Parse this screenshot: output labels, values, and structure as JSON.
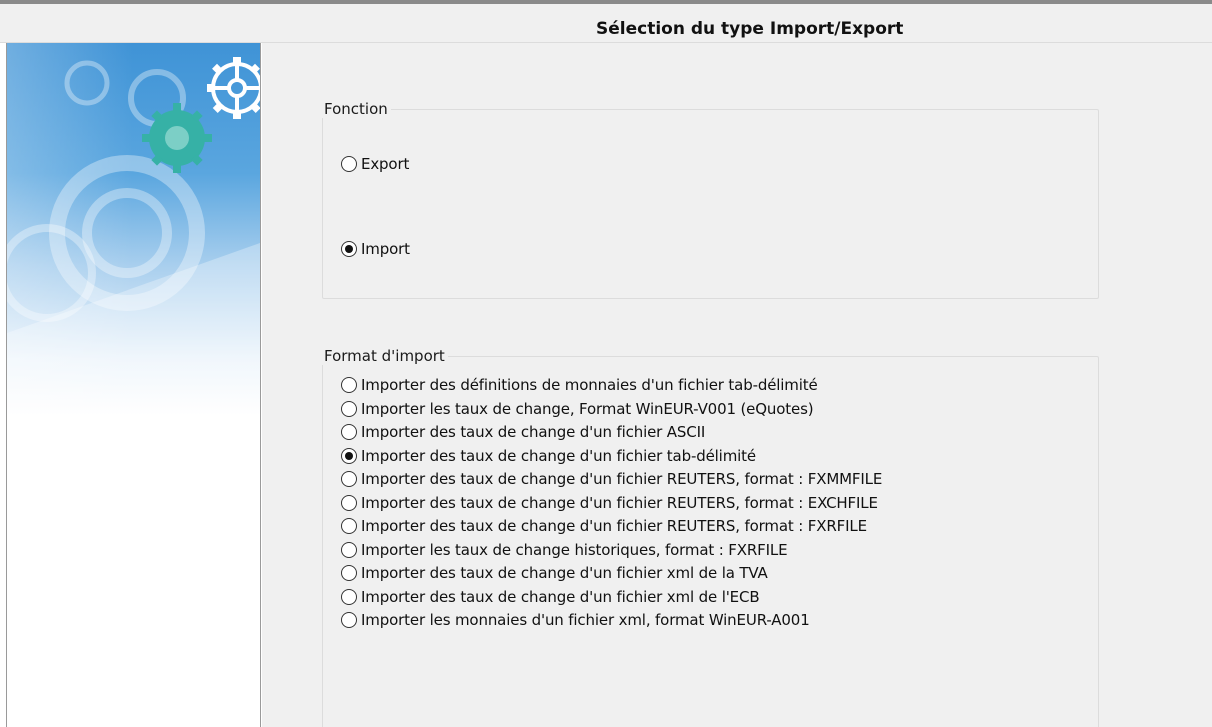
{
  "window": {
    "title": "Sélection du type Import/Export"
  },
  "sidebar": {
    "banner_icon": "gears-icon"
  },
  "fonction": {
    "title": "Fonction",
    "options": [
      {
        "label": "Export",
        "selected": false
      },
      {
        "label": "Import",
        "selected": true
      }
    ]
  },
  "format": {
    "title": "Format d'import",
    "options": [
      {
        "label": "Importer des définitions de monnaies d'un fichier tab-délimité",
        "selected": false
      },
      {
        "label": "Importer les taux de change, Format WinEUR-V001 (eQuotes)",
        "selected": false
      },
      {
        "label": "Importer des taux de change d'un fichier ASCII",
        "selected": false
      },
      {
        "label": "Importer des taux de change d'un fichier tab-délimité",
        "selected": true
      },
      {
        "label": "Importer des taux de change d'un fichier REUTERS, format : FXMMFILE",
        "selected": false
      },
      {
        "label": "Importer des taux de change d'un fichier REUTERS, format : EXCHFILE",
        "selected": false
      },
      {
        "label": "Importer des taux de change d'un fichier REUTERS, format : FXRFILE",
        "selected": false
      },
      {
        "label": "Importer les taux de change historiques, format : FXRFILE",
        "selected": false
      },
      {
        "label": "Importer des taux de change d'un fichier xml de la TVA",
        "selected": false
      },
      {
        "label": "Importer des taux de change d'un fichier xml de l'ECB",
        "selected": false
      },
      {
        "label": "Importer les monnaies d'un fichier xml, format WinEUR-A001",
        "selected": false
      }
    ]
  },
  "colors": {
    "banner_blue": "#3f93d6",
    "banner_green": "#3bb2a8",
    "panel_bg": "#f0f0f0"
  }
}
